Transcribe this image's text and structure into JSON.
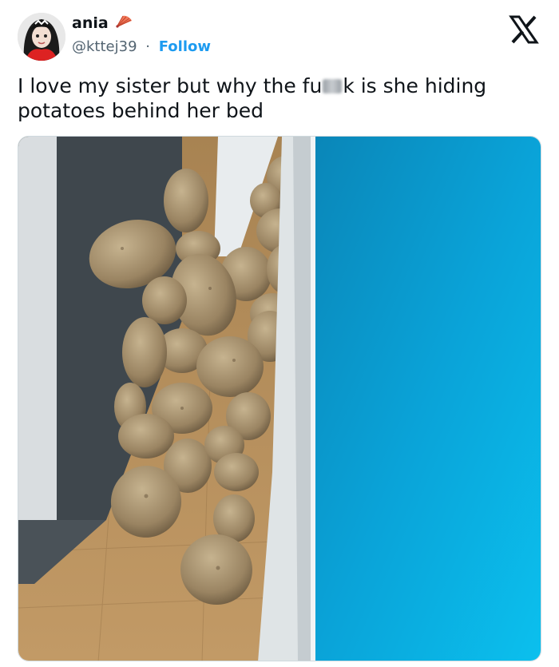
{
  "author": {
    "name": "ania",
    "handle": "@kttej39",
    "separator": "·",
    "follow_label": "Follow"
  },
  "tweet": {
    "text_part1": "I love my sister but why the fu",
    "text_part2": "k is she hiding potatoes behind her bed"
  },
  "colors": {
    "follow_blue": "#1d9bf0",
    "wall_teal": "#0aa8dd",
    "floor_wood": "#b08a58"
  },
  "icons": {
    "brand": "x-logo-icon",
    "badge": "fan-emoji-icon"
  }
}
